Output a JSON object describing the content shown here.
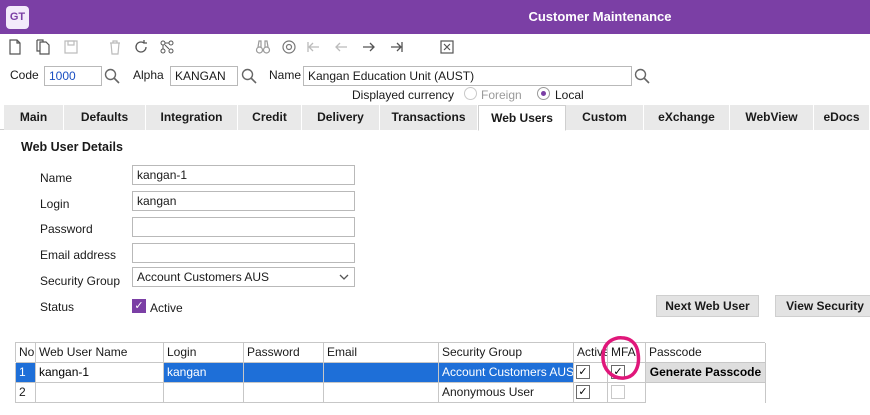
{
  "app": {
    "logo": "GT",
    "title": "Customer Maintenance"
  },
  "toolbar": {
    "icons": [
      "new-document-icon",
      "copy-icon",
      "save-icon",
      "delete-icon",
      "refresh-icon",
      "hierarchy-icon",
      "binoculars-icon",
      "navigate-icon",
      "first-record-icon",
      "previous-record-icon",
      "next-record-icon",
      "last-record-icon",
      "close-form-icon"
    ]
  },
  "header": {
    "code_label": "Code",
    "code_value": "1000",
    "alpha_label": "Alpha",
    "alpha_value": "KANGAN",
    "name_label": "Name",
    "name_value": "Kangan Education Unit (AUST)",
    "currency_label": "Displayed currency",
    "currency_options": [
      "Foreign",
      "Local"
    ],
    "currency_selected": "Local"
  },
  "tabs": [
    "Main",
    "Defaults",
    "Integration",
    "Credit",
    "Delivery",
    "Transactions",
    "Web Users",
    "Custom",
    "eXchange",
    "WebView",
    "eDocs"
  ],
  "active_tab": "Web Users",
  "details": {
    "title": "Web User Details",
    "name_label": "Name",
    "name_value": "kangan-1",
    "login_label": "Login",
    "login_value": "kangan",
    "password_label": "Password",
    "password_value": "",
    "email_label": "Email address",
    "email_value": "",
    "group_label": "Security Group",
    "group_value": "Account Customers AUS",
    "status_label": "Status",
    "status_value": "Active",
    "status_checked": true
  },
  "buttons": {
    "next_user": "Next Web User",
    "view_security": "View Security",
    "generate": "Generate Passcode"
  },
  "grid": {
    "columns": [
      "No.",
      "Web User Name",
      "Login",
      "Password",
      "Email",
      "Security Group",
      "Active",
      "MFA",
      "Passcode"
    ],
    "rows": [
      {
        "no": "1",
        "name": "kangan-1",
        "login": "kangan",
        "password": "",
        "email": "",
        "group": "Account Customers AUS",
        "active": true,
        "mfa": true,
        "selected": true
      },
      {
        "no": "2",
        "name": "",
        "login": "",
        "password": "",
        "email": "",
        "group": "Anonymous User",
        "active": true,
        "mfa": false,
        "selected": false
      }
    ]
  },
  "colors": {
    "brand": "#7b3fa5",
    "selection": "#1e6fd8",
    "annotation": "#e0177a"
  }
}
